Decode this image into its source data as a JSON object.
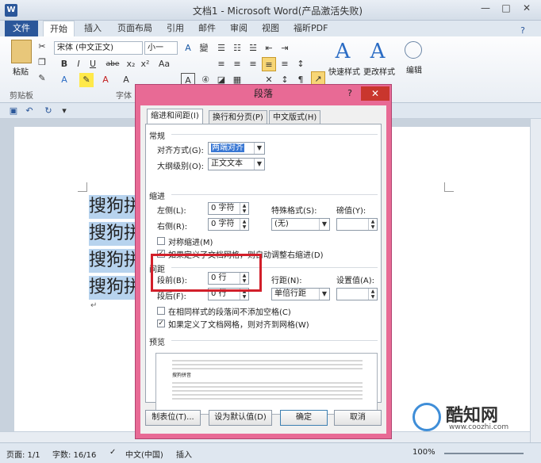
{
  "window": {
    "title": "文档1 - Microsoft Word(产品激活失败)",
    "app_icon": "W",
    "controls": [
      "—",
      "□",
      "✕"
    ]
  },
  "tabs": [
    "文件",
    "开始",
    "插入",
    "页面布局",
    "引用",
    "邮件",
    "审阅",
    "视图",
    "福昕PDF"
  ],
  "ribbon": {
    "paste_label": "粘贴",
    "font_name": "宋体 (中文正文)",
    "font_size": "小一",
    "font_btns": [
      "B",
      "I",
      "U",
      "abe",
      "x₂",
      "x²",
      "Aa"
    ],
    "groups": [
      "剪贴板",
      "字体"
    ],
    "right_labels": [
      "快速样式",
      "更改样式",
      "编辑"
    ],
    "style_glyph": "A"
  },
  "document": {
    "lines": [
      "搜狗拼",
      "搜狗拼",
      "搜狗拼",
      "搜狗拼"
    ],
    "para_mark": "↵"
  },
  "status": {
    "page": "页面: 1/1",
    "words": "字数: 16/16",
    "lang": "中文(中国)",
    "mode": "插入",
    "zoom": "100%"
  },
  "watermark": {
    "text": "酷知网",
    "url": "www.coozhi.com"
  },
  "dialog": {
    "title": "段落",
    "help": "?",
    "close": "✕",
    "tabs": [
      "缩进和间距(I)",
      "换行和分页(P)",
      "中文版式(H)"
    ],
    "general": {
      "section": "常规",
      "align_label": "对齐方式(G):",
      "align_value": "两端对齐",
      "outline_label": "大纲级别(O):",
      "outline_value": "正文文本"
    },
    "indent": {
      "section": "缩进",
      "left_label": "左侧(L):",
      "left_value": "0 字符",
      "right_label": "右侧(R):",
      "right_value": "0 字符",
      "special_label": "特殊格式(S):",
      "special_value": "(无)",
      "measure_label": "磅值(Y):",
      "mirror": "对称缩进(M)",
      "auto_adjust": "如果定义了文档网格，则自动调整右缩进(D)"
    },
    "spacing": {
      "section": "间距",
      "before_label": "段前(B):",
      "before_value": "0 行",
      "after_label": "段后(F):",
      "after_value": "0 行",
      "line_label": "行距(N):",
      "line_value": "单倍行距",
      "setting_label": "设置值(A):",
      "no_space": "在相同样式的段落间不添加空格(C)",
      "snap": "如果定义了文档网格，则对齐到网格(W)"
    },
    "preview": {
      "section": "预览",
      "sample": "搜狗拼音"
    },
    "buttons": {
      "tabs": "制表位(T)...",
      "default": "设为默认值(D)",
      "ok": "确定",
      "cancel": "取消"
    }
  }
}
